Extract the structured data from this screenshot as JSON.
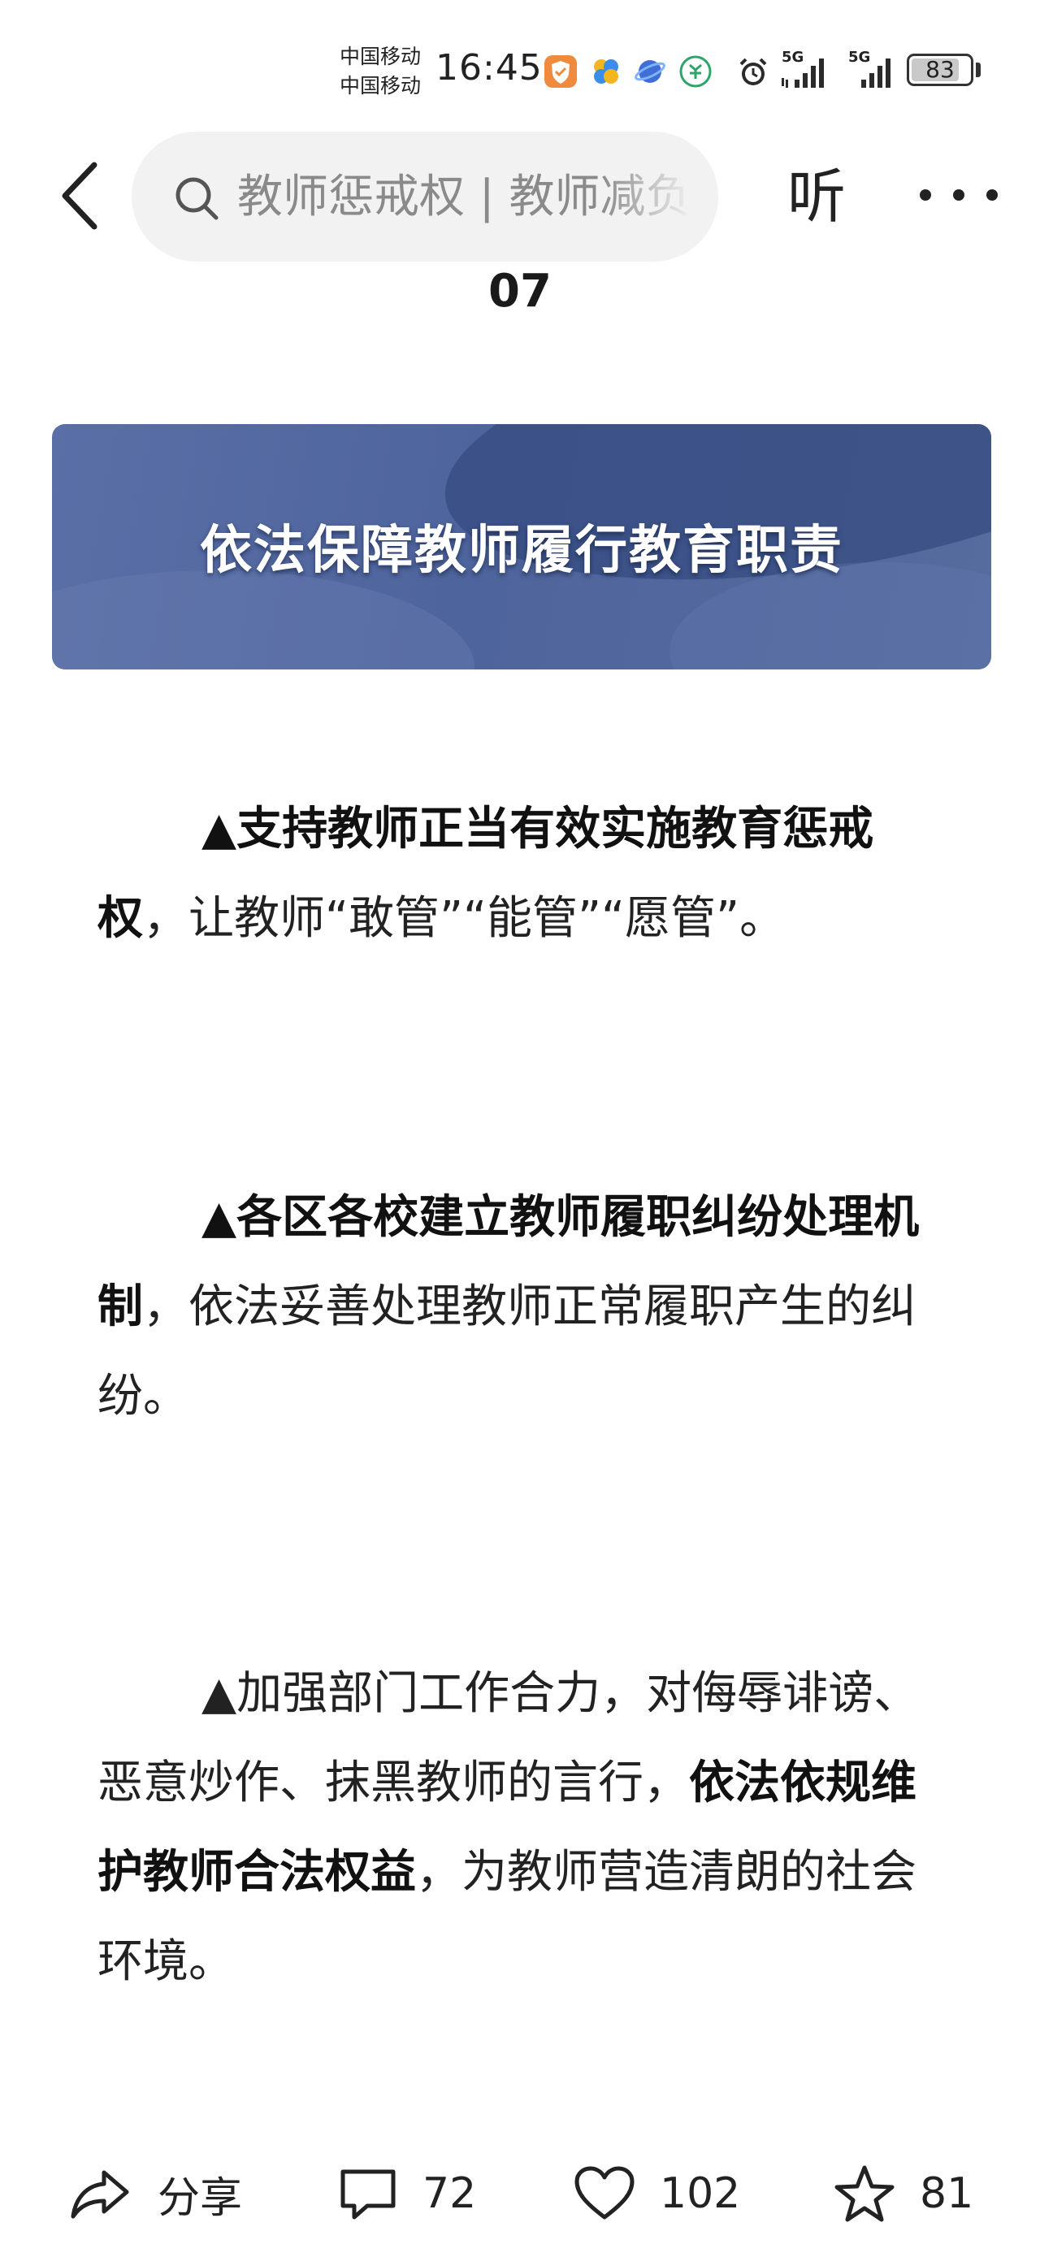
{
  "status_bar": {
    "carrier_1": "中国移动",
    "carrier_2": "中国移动",
    "time": "16:45",
    "network_1": "5G",
    "network_2": "5G",
    "battery": "83",
    "battery_level": 0.83,
    "icons": [
      "shield-app-icon",
      "pinwheel-app-icon",
      "planet-app-icon",
      "bank-app-icon",
      "alarm-icon",
      "signal-icon",
      "signal-icon",
      "battery-icon"
    ]
  },
  "nav": {
    "search_placeholder": "教师惩戒权 | 教师减负",
    "listen_label": "听"
  },
  "article": {
    "section_number": "07",
    "banner_title": "依法保障教师履行教育职责",
    "paragraphs": [
      {
        "lead": "▲",
        "bold": "支持教师正当有效实施教育惩戒权",
        "rest": "，让教师“敢管”“能管”“愿管”。"
      },
      {
        "lead": "▲",
        "bold": "各区各校建立教师履职纠纷处理机制",
        "rest": "，依法妥善处理教师正常履职产生的纠纷。"
      },
      {
        "lead": "▲",
        "pre": "加强部门工作合力，对侮辱诽谤、恶意炒作、抹黑教师的言行，",
        "bold": "依法依规维护教师合法权益",
        "rest": "，为教师营造清朗的社会环境。"
      }
    ]
  },
  "actions": {
    "share_label": "分享",
    "comment_count": "72",
    "like_count": "102",
    "favorite_count": "81"
  },
  "colors": {
    "banner": "#5a6fa6",
    "text": "#222222",
    "search_bg": "#f2f2f3"
  }
}
